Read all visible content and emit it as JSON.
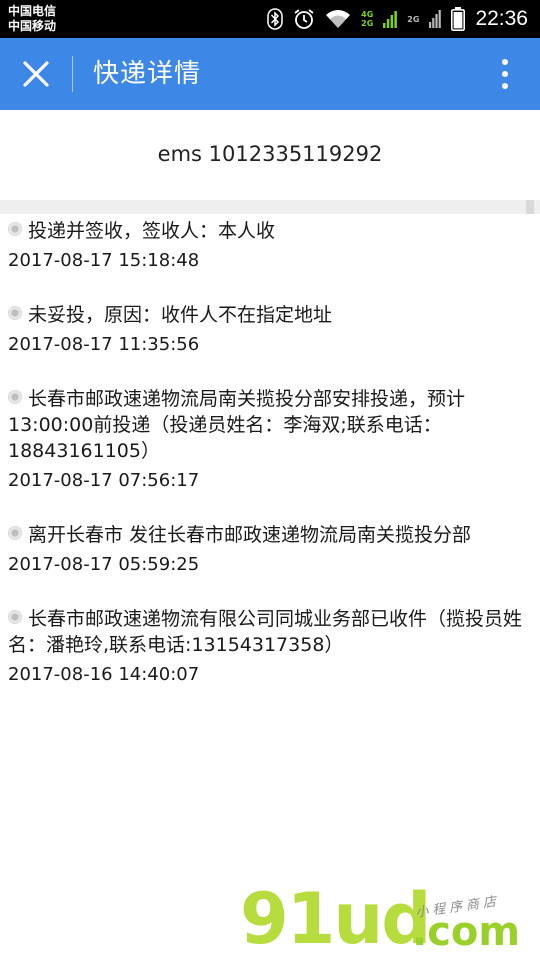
{
  "status_bar": {
    "carrier_1": "中国电信",
    "carrier_2": "中国移动",
    "signal_1_top": "4G",
    "signal_1_bottom": "2G",
    "signal_2": "2G",
    "time": "22:36"
  },
  "header": {
    "title": "快递详情"
  },
  "tracking": {
    "number": "ems 1012335119292"
  },
  "events": [
    {
      "desc": "投递并签收，签收人：本人收",
      "time": "2017-08-17 15:18:48"
    },
    {
      "desc": "未妥投，原因：收件人不在指定地址",
      "time": "2017-08-17 11:35:56"
    },
    {
      "desc": "长春市邮政速递物流局南关揽投分部安排投递，预计13:00:00前投递（投递员姓名：李海双;联系电话：18843161105）",
      "time": "2017-08-17 07:56:17"
    },
    {
      "desc": "离开长春市 发往长春市邮政速递物流局南关揽投分部",
      "time": "2017-08-17 05:59:25"
    },
    {
      "desc": "长春市邮政速递物流有限公司同城业务部已收件（揽投员姓名：潘艳玲,联系电话:13154317358）",
      "time": "2017-08-16 14:40:07"
    }
  ],
  "watermark": {
    "logo": "91ud",
    "suffix": ".com",
    "tagline": "小程序商店"
  },
  "colors": {
    "header_bg": "#3d87e6",
    "status_bg": "#000000",
    "signal_green": "#7ed321",
    "watermark_green": "#b6dc3e"
  },
  "icons": [
    "bluetooth-icon",
    "alarm-icon",
    "wifi-icon",
    "battery-icon",
    "close-icon",
    "more-vertical-icon",
    "timeline-dot-icon"
  ]
}
